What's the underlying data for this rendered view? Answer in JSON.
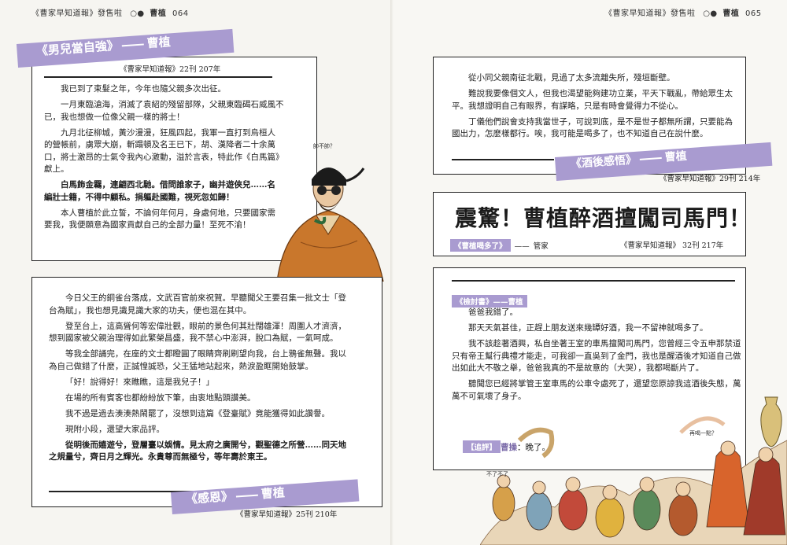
{
  "left_page": {
    "header": {
      "publication": "《曹家早知道報》發售啦",
      "mark": "○●",
      "section": "曹植",
      "page_number": "064"
    },
    "article1": {
      "title": "《男兒當自強》",
      "author": "曹植",
      "source": "《曹家早知道報》22刊 207年",
      "paragraphs": [
        "我已到了束髮之年，今年也隨父親多次出征。",
        "一月東臨滄海，消滅了袁紹的殘留部隊，父親東臨碣石威風不已，我也想做一位像父親一樣的將士！",
        "九月北征柳城，黃沙漫漫，狂風四起，我軍一直打到烏桓人的營帳前，虜眾大崩，斬蹋頓及名王已下，胡、漢降者二十余萬口，將士激昂的士氣令我內心激動，溢於言表，特此作《白馬篇》獻上。",
        "白馬飾金羈，連翩西北馳。借問誰家子，幽并遊俠兒……名編壯士籍，不得中顧私。捐軀赴國難，視死忽如歸！",
        "本人曹植於此立誓，不論何年何月，身處何地，只要國家需要我，我便願意為國家貢獻自己的全部力量！至死不渝！"
      ],
      "handwriting": "帥不帥？"
    },
    "article2": {
      "paragraphs": [
        "今日父王的銅雀台落成，文武百官前來祝賀。早聽聞父王要召集一批文士「登台為賦」，我也想見識見識大家的功夫，便也混在其中。",
        "登至台上，這高聳何等宏偉壯觀，眼前的景色何其壯闊雄渾！周圍人才濟濟，想到國家被父親治理得如此繁榮昌盛，我不禁心中澎湃，脫口為賦，一氣呵成。",
        "等我全部誦完，在座的文士都瞪圓了眼睛齊刷刷望向我，台上鴉雀無聲。我以為自己做錯了什麼，正誠惶誠恐，父王猛地站起來，熱淚盈眶開始鼓掌。",
        "「好！說得好！來瞧瞧，這是我兒子！」",
        "在場的所有賓客也都紛紛放下筆，由衷地點頭讚美。",
        "我不過是過去湊湊熱鬧罷了，沒想到這篇《登臺賦》竟能獲得如此讚譽。",
        "現附小段，還望大家品評。",
        "從明後而嬉遊兮，登層臺以娛情。見太府之廣開兮，觀聖德之所營……同天地之規量兮，齊日月之輝光。永貴尊而無極兮，等年壽於東王。"
      ],
      "title": "《感恩》",
      "author": "曹植",
      "source": "《曹家早知道報》25刊 210年"
    }
  },
  "right_page": {
    "header": {
      "publication": "《曹家早知道報》發售啦",
      "mark": "○●",
      "section": "曹植",
      "page_number": "065"
    },
    "article3": {
      "paragraphs": [
        "從小同父親南征北戰，見過了太多流離失所，殘垣斷壁。",
        "難說我要像個文人，但我也渴望能夠建功立業，平天下戰亂，帶給眾生太平。我想證明自己有眼界，有謀略，只是有時會覺得力不從心。",
        "丁儀他們說會支持我當世子，可說到底，是不是世子都無所謂，只要能為國出力，怎麼樣都行。唉，我可能是喝多了，也不知道自己在說什麼。"
      ],
      "title": "《酒後感悟》",
      "author": "曹植",
      "source": "《曹家早知道報》29刊 214年"
    },
    "headline": {
      "text": "震驚！曹植醉酒擅闖司馬門！",
      "byline": "《曹植喝多了》",
      "byline_author": "管家",
      "source": "《曹家早知道報》 32刊 217年"
    },
    "article4": {
      "title": "《檢討書》",
      "author": "曹植",
      "paragraphs": [
        "爸爸我錯了。",
        "那天天氣甚佳，正趕上朋友送來幾罈好酒，我一不留神就喝多了。",
        "我不該趁著酒興，私自坐著王室的車馬擅闖司馬門，您曾經三令五申那禁道只有帝王幫行典禮才能走，可我卻一直吳到了金門，我也是醒酒後才知道自己做出如此大不敬之舉，爸爸我真的不是故意的（大哭），我都喝斷片了。",
        "聽聞您已經將掌管王室車馬的公車令處死了，還望您原諒我這酒後失態，萬萬不可氣壞了身子。"
      ],
      "comment_tag": "【追評】",
      "comment_author": "曹操",
      "comment_text": "：晚了。",
      "handwriting_1": "再喝一點？",
      "handwriting_2": "不了不了"
    }
  }
}
